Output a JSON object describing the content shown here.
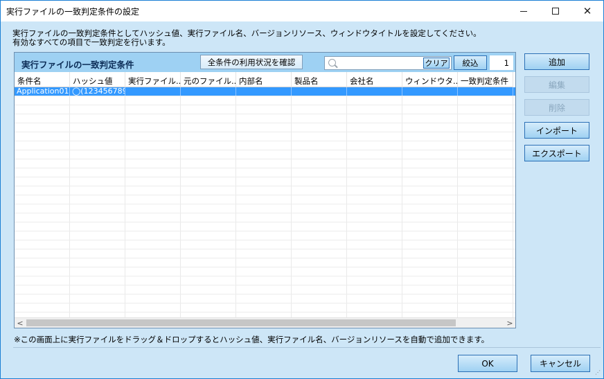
{
  "window": {
    "title": "実行ファイルの一致判定条件の設定"
  },
  "description": {
    "line1": "実行ファイルの一致判定条件としてハッシュ値、実行ファイル名、バージョンリソース、ウィンドウタイトルを設定してください。",
    "line2": "有効なすべての項目で一致判定を行います。"
  },
  "panel": {
    "title": "実行ファイルの一致判定条件",
    "check_all_label": "全条件の利用状況を確認",
    "search": {
      "value": "",
      "placeholder": ""
    },
    "clear_label": "クリア",
    "narrow_label": "絞込",
    "count": "1"
  },
  "table": {
    "columns": [
      "条件名",
      "ハッシュ値",
      "実行ファイル...",
      "元のファイル...",
      "内部名",
      "製品名",
      "会社名",
      "ウィンドウタ...",
      "一致判定条件"
    ],
    "rows": [
      [
        "Application01...",
        "◯(123456789...",
        "",
        "",
        "",
        "",
        "",
        "",
        ""
      ]
    ]
  },
  "side_buttons": {
    "add": "追加",
    "edit": "編集",
    "delete": "削除",
    "import": "インポート",
    "export": "エクスポート"
  },
  "footer": {
    "note": "※この画面上に実行ファイルをドラッグ＆ドロップするとハッシュ値、実行ファイル名、バージョンリソースを自動で追加できます。",
    "ok": "OK",
    "cancel": "キャンセル"
  },
  "colors": {
    "dialog_bg": "#cde6f7",
    "panel_header": "#9ed1f3",
    "selection": "#3399ff",
    "button": "#9fd1f2"
  }
}
